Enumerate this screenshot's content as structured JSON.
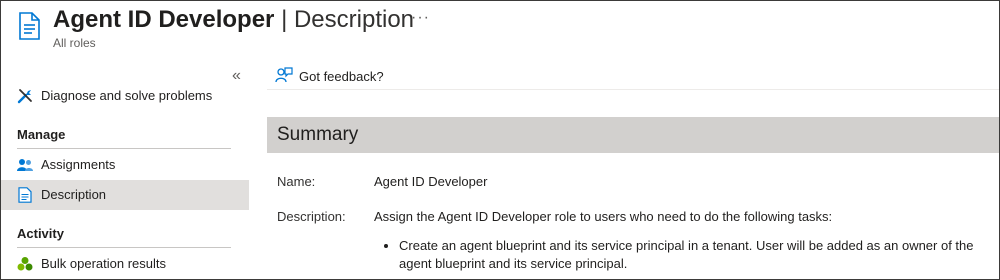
{
  "header": {
    "title": "Agent ID Developer",
    "separator": "|",
    "subtitle": "Description",
    "more": "···",
    "breadcrumb": "All roles",
    "icon": "document-icon"
  },
  "sidebar": {
    "collapse_glyph": "«",
    "items": [
      {
        "label": "Diagnose and solve problems",
        "icon": "wrench-icon"
      }
    ],
    "sections": [
      {
        "title": "Manage",
        "items": [
          {
            "label": "Assignments",
            "icon": "users-icon"
          },
          {
            "label": "Description",
            "icon": "document-icon",
            "selected": true
          }
        ]
      },
      {
        "title": "Activity",
        "items": [
          {
            "label": "Bulk operation results",
            "icon": "bulk-operation-icon"
          }
        ]
      }
    ]
  },
  "content": {
    "feedback_label": "Got feedback?",
    "summary_title": "Summary",
    "fields": [
      {
        "label": "Name:",
        "value": "Agent ID Developer"
      },
      {
        "label": "Description:",
        "value": "Assign the Agent ID Developer role to users who need to do the following tasks:"
      }
    ],
    "bullets": [
      "Create an agent blueprint and its service principal in a tenant. User will be added as an owner of the agent blueprint and its service principal."
    ]
  },
  "colors": {
    "accent": "#0078d4",
    "selected_bg": "#e1dfdd",
    "summary_bg": "#d2d0ce"
  }
}
